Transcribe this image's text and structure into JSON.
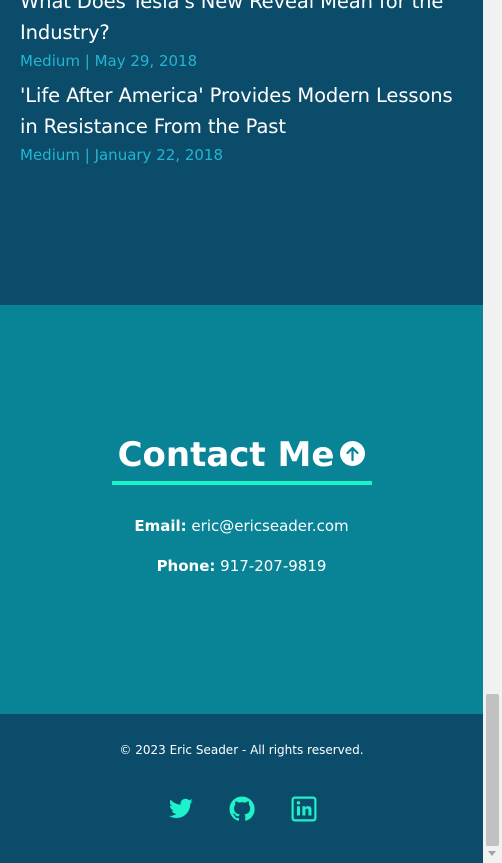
{
  "articles": [
    {
      "title": "What Does Tesla's New Reveal Mean for the Industry?",
      "meta": "Medium | May 29, 2018"
    },
    {
      "title": "'Life After America' Provides Modern Lessons in Resistance From the Past",
      "meta": "Medium | January 22, 2018"
    }
  ],
  "contact": {
    "heading": "Contact Me",
    "email_label": "Email:",
    "email_value": "eric@ericseader.com",
    "phone_label": "Phone:",
    "phone_value": "917-207-9819"
  },
  "footer": {
    "copyright": "© 2023 Eric Seader - All rights reserved.",
    "social_icons": [
      "twitter-icon",
      "github-icon",
      "linkedin-icon"
    ]
  },
  "colors": {
    "dark_blue": "#0a4c6a",
    "teal": "#088496",
    "accent": "#1ef2cb",
    "meta_text": "#22b6d2"
  }
}
